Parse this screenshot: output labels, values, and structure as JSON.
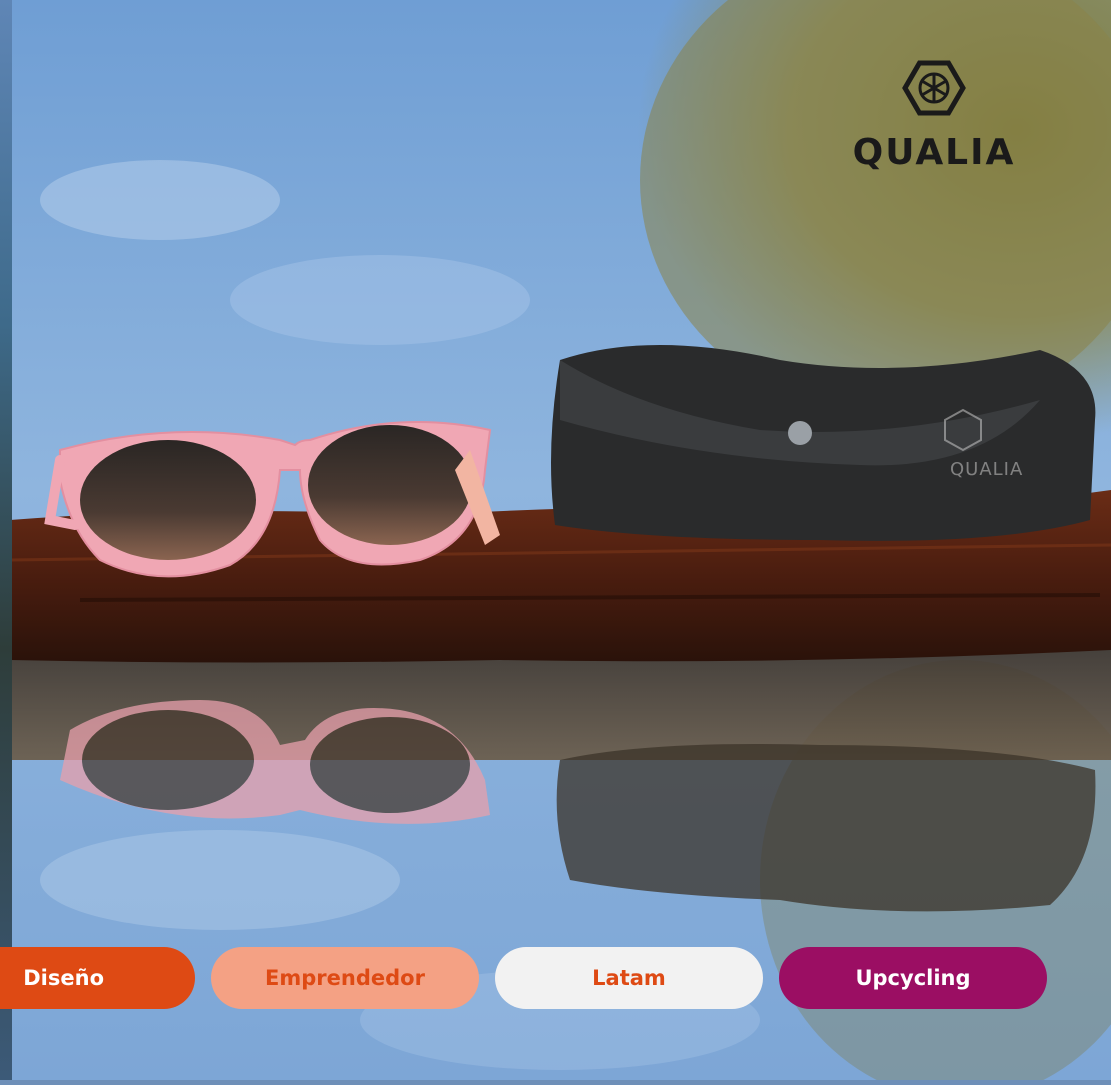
{
  "brand": {
    "name": "QUALIA",
    "icon": "hexagon-asterisk-icon"
  },
  "photo": {
    "subject": "pink sunglasses and black upcycled leather case on a log, reflected in water",
    "case_emboss_text": "QUALIA"
  },
  "tags": [
    {
      "label": "Diseño",
      "bg": "#de4a14",
      "fg": "#ffffff"
    },
    {
      "label": "Emprendedor",
      "bg": "#f4a184",
      "fg": "#de4a14"
    },
    {
      "label": "Latam",
      "bg": "#f2f2f2",
      "fg": "#de4a14"
    },
    {
      "label": "Upcycling",
      "bg": "#9b0e63",
      "fg": "#ffffff"
    }
  ]
}
